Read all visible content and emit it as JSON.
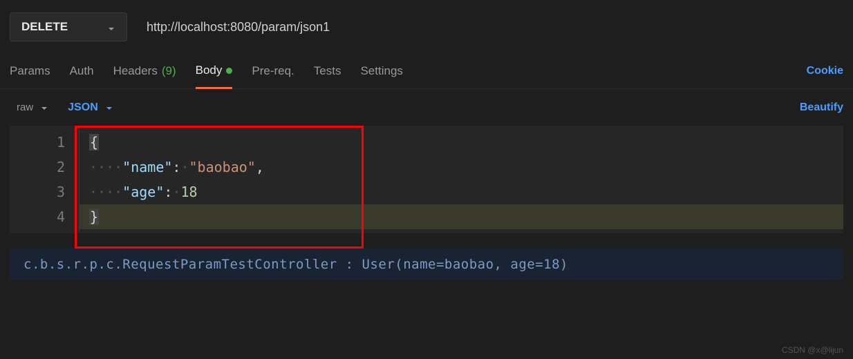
{
  "request": {
    "method": "DELETE",
    "url": "http://localhost:8080/param/json1"
  },
  "tabs": {
    "params": "Params",
    "auth": "Auth",
    "headers_label": "Headers",
    "headers_count": "(9)",
    "body": "Body",
    "prereq": "Pre-req.",
    "tests": "Tests",
    "settings": "Settings",
    "cookies": "Cookie"
  },
  "body_controls": {
    "raw": "raw",
    "format": "JSON",
    "beautify": "Beautify"
  },
  "editor": {
    "line_numbers": [
      "1",
      "2",
      "3",
      "4"
    ],
    "body_json": {
      "name": "baobao",
      "age": 18
    },
    "tokens": {
      "open_brace": "{",
      "key_name": "\"name\"",
      "val_name": "\"baobao\"",
      "key_age": "\"age\"",
      "val_age": "18",
      "close_brace": "}",
      "colon": ":",
      "comma": ",",
      "indent": "····",
      "space": "·"
    }
  },
  "log": {
    "text": "c.b.s.r.p.c.RequestParamTestController   : User(name=baobao, age=18)"
  },
  "watermark": "CSDN @x@lijun"
}
